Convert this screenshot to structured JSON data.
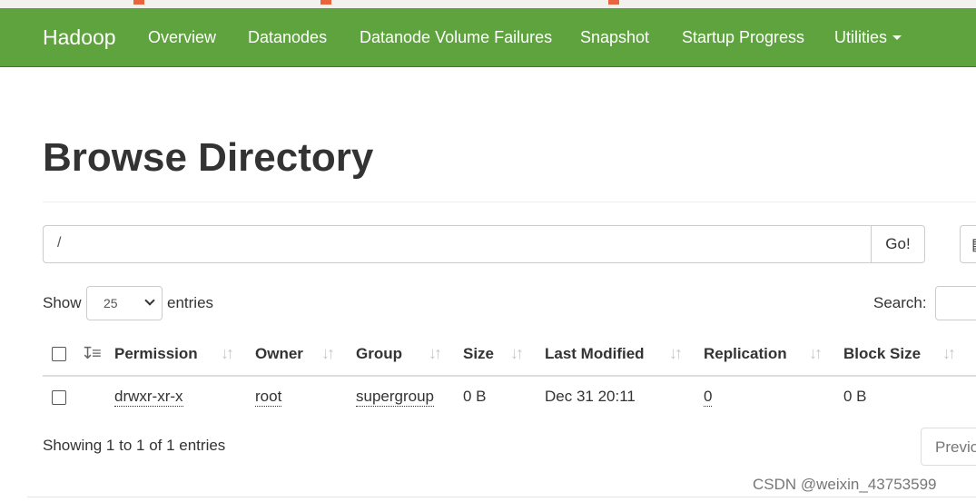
{
  "navbar": {
    "brand": "Hadoop",
    "items": [
      "Overview",
      "Datanodes",
      "Datanode Volume Failures",
      "Snapshot",
      "Startup Progress",
      "Utilities"
    ],
    "color": "#5fa33e"
  },
  "page": {
    "title": "Browse Directory"
  },
  "path_bar": {
    "value": "/",
    "go_label": "Go!"
  },
  "table_controls": {
    "show_label": "Show",
    "page_size": "25",
    "entries_label": "entries",
    "search_label": "Search:",
    "search_value": ""
  },
  "table": {
    "columns": [
      "Permission",
      "Owner",
      "Group",
      "Size",
      "Last Modified",
      "Replication",
      "Block Size"
    ],
    "rows": [
      {
        "permission": "drwxr-xr-x",
        "owner": "root",
        "group": "supergroup",
        "size": "0 B",
        "last_modified": "Dec 31 20:11",
        "replication": "0",
        "block_size": "0 B"
      }
    ]
  },
  "footer": {
    "info": "Showing 1 to 1 of 1 entries",
    "previous_label": "Previous"
  },
  "watermark": "CSDN @weixin_43753599"
}
